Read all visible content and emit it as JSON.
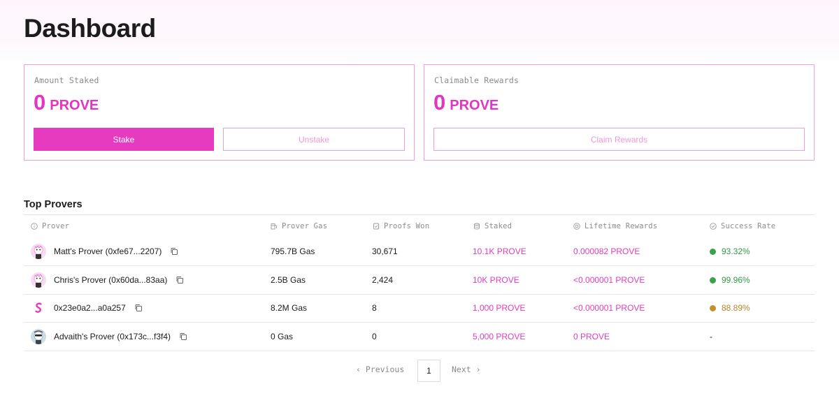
{
  "page": {
    "title": "Dashboard"
  },
  "staked_card": {
    "label": "Amount Staked",
    "amount": "0",
    "unit": "PROVE",
    "stake_label": "Stake",
    "unstake_label": "Unstake"
  },
  "rewards_card": {
    "label": "Claimable Rewards",
    "amount": "0",
    "unit": "PROVE",
    "claim_label": "Claim Rewards"
  },
  "provers": {
    "title": "Top Provers",
    "columns": {
      "prover": "Prover",
      "gas": "Prover Gas",
      "proofs": "Proofs Won",
      "staked": "Staked",
      "rewards": "Lifetime Rewards",
      "success": "Success Rate"
    },
    "rows": [
      {
        "name": "Matt's Prover (0xfe67...2207)",
        "gas": "795.7B Gas",
        "proofs": "30,671",
        "staked": "10.1K PROVE",
        "rewards": "0.000082 PROVE",
        "success": "93.32%",
        "status_color": "#3aa34a"
      },
      {
        "name": "Chris's Prover (0x60da...83aa)",
        "gas": "2.5B Gas",
        "proofs": "2,424",
        "staked": "10K PROVE",
        "rewards": "<0.000001 PROVE",
        "success": "99.96%",
        "status_color": "#3aa34a"
      },
      {
        "name": "0x23e0a2...a0a257",
        "gas": "8.2M Gas",
        "proofs": "8",
        "staked": "1,000 PROVE",
        "rewards": "<0.000001 PROVE",
        "success": "88.89%",
        "status_color": "#c48f2f"
      },
      {
        "name": "Advaith's Prover (0x173c...f3f4)",
        "gas": "0 Gas",
        "proofs": "0",
        "staked": "5,000 PROVE",
        "rewards": "0 PROVE",
        "success": "-",
        "status_color": ""
      }
    ]
  },
  "pagination": {
    "previous": "Previous",
    "next": "Next",
    "current": "1"
  },
  "colors": {
    "accent": "#e63abf",
    "card_border": "#ee9fdc",
    "success_green": "#3aa34a",
    "warning_amber": "#c48f2f"
  }
}
